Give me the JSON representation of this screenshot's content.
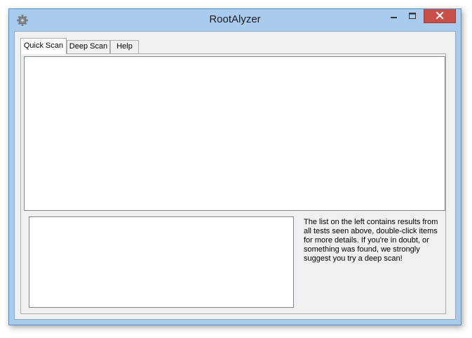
{
  "window": {
    "title": "RootAlyzer"
  },
  "tabs": [
    {
      "label": "Quick Scan",
      "active": true
    },
    {
      "label": "Deep Scan",
      "active": false
    },
    {
      "label": "Help",
      "active": false
    }
  ],
  "quick_scan": {
    "info_text": "The list on the left contains results from all tests seen above, double-click items for more details. If you're in doubt, or something was found, we strongly suggest you try a deep scan!"
  },
  "icons": {
    "app": "gear-icon",
    "minimize": "minimize-icon",
    "maximize": "maximize-icon",
    "close": "close-icon"
  },
  "colors": {
    "frame": "#a9cbee",
    "close_button": "#c7504a",
    "client_background": "#f0f0f0"
  }
}
